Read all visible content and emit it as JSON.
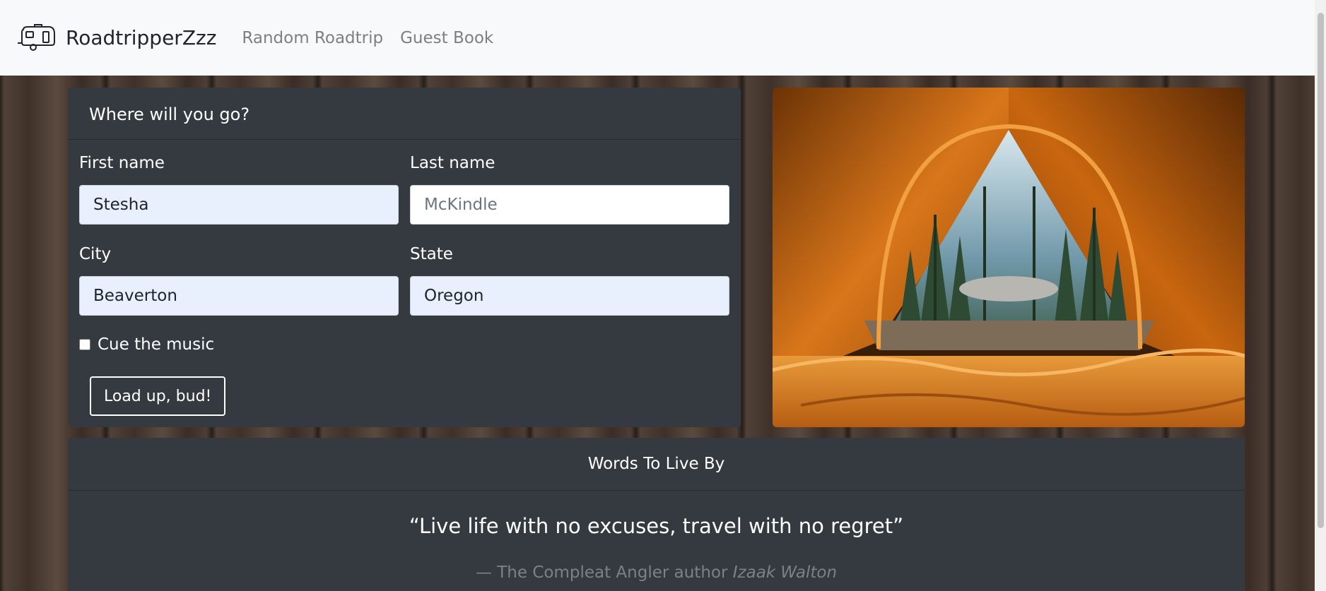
{
  "navbar": {
    "brand": "RoadtripperZzz",
    "brand_icon": "camper-trailer-icon",
    "links": [
      "Random Roadtrip",
      "Guest Book"
    ]
  },
  "form": {
    "header": "Where will you go?",
    "first_name": {
      "label": "First name",
      "value": "Stesha"
    },
    "last_name": {
      "label": "Last name",
      "placeholder": "McKindle"
    },
    "city": {
      "label": "City",
      "value": "Beaverton"
    },
    "state": {
      "label": "State",
      "value": "Oregon"
    },
    "music_checkbox": {
      "label": "Cue the music",
      "checked": false
    },
    "submit_label": "Load up, bud!"
  },
  "photo": {
    "subject": "view-from-tent-into-forest"
  },
  "quote": {
    "header": "Words To Live By",
    "text": "“Live life with no excuses, travel with no regret”",
    "footer_prefix": "— The Compleat Angler author ",
    "footer_cite": "Izaak Walton"
  },
  "colors": {
    "navbar_bg": "#f8f9fa",
    "card_bg": "#343a40",
    "autofill_bg": "#e8f0fe",
    "tent_orange": "#d9761a"
  }
}
